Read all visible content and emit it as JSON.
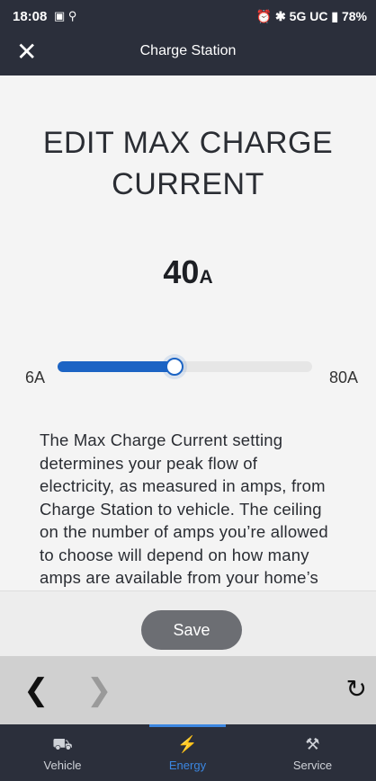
{
  "status_bar": {
    "time": "18:08",
    "network": "5G UC",
    "battery": "78%"
  },
  "header": {
    "title": "Charge Station"
  },
  "main": {
    "heading_line1": "EDIT MAX CHARGE",
    "heading_line2": "CURRENT",
    "value_number": "40",
    "value_unit": "A",
    "slider": {
      "min_label": "6A",
      "max_label": "80A",
      "min": 6,
      "max": 80,
      "value": 40
    },
    "description": "The Max Charge Current setting determines your peak flow of electricity, as measured in amps, from Charge Station to vehicle. The ceiling on the number of amps you’re allowed to choose will depend on how many amps are available from your home’s"
  },
  "save_button_label": "Save",
  "tabs": [
    {
      "label": "Vehicle",
      "icon": "car-icon",
      "active": false
    },
    {
      "label": "Energy",
      "icon": "lightning-icon",
      "active": true
    },
    {
      "label": "Service",
      "icon": "tools-icon",
      "active": false
    }
  ],
  "colors": {
    "accent": "#1c64c4",
    "tab_active": "#3b86e0",
    "header_bg": "#2b2f3b"
  }
}
